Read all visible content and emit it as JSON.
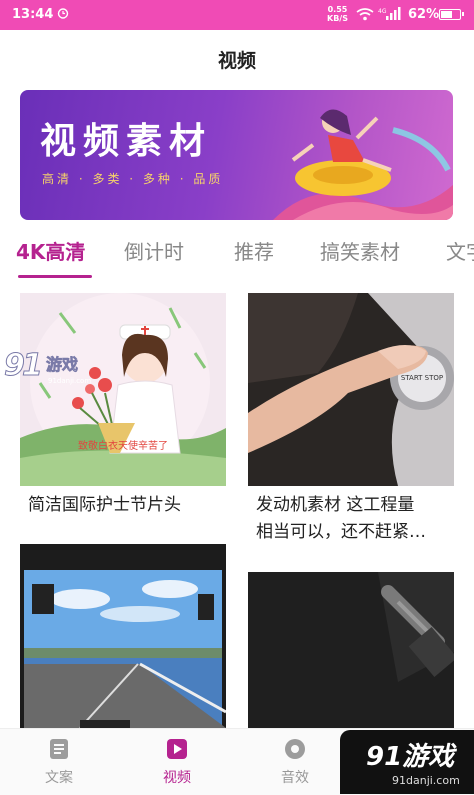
{
  "status_bar": {
    "time": "13:44",
    "net_speed_value": "0.55",
    "net_speed_unit": "KB/S",
    "network_type": "4G",
    "battery": "62%",
    "battery_level": 0.62
  },
  "page": {
    "title": "视频"
  },
  "banner": {
    "title": "视频素材",
    "subtitle": "高清 · 多类 · 多种 · 品质"
  },
  "tabs": [
    {
      "label": "4K高清",
      "active": true
    },
    {
      "label": "倒计时",
      "active": false
    },
    {
      "label": "推荐",
      "active": false
    },
    {
      "label": "搞笑素材",
      "active": false
    },
    {
      "label": "文字",
      "active": false
    }
  ],
  "cards": [
    {
      "title": "简洁国际护士节片头",
      "overlay_text": "致敬白衣天使辛苦了"
    },
    {
      "title_line1": "发动机素材 这工程量",
      "title_line2": "相当可以，还不赶紧…",
      "button_text": "START STOP"
    },
    {
      "title": ""
    },
    {
      "title": ""
    }
  ],
  "bottom_nav": [
    {
      "label": "文案",
      "icon": "document-icon",
      "active": false
    },
    {
      "label": "视频",
      "icon": "play-icon",
      "active": true
    },
    {
      "label": "音效",
      "icon": "music-icon",
      "active": false
    }
  ],
  "watermark": {
    "logo": "91游戏",
    "domain": "91danji.com"
  },
  "colors": {
    "status_bar": "#f04bb5",
    "accent": "#b5228f"
  }
}
